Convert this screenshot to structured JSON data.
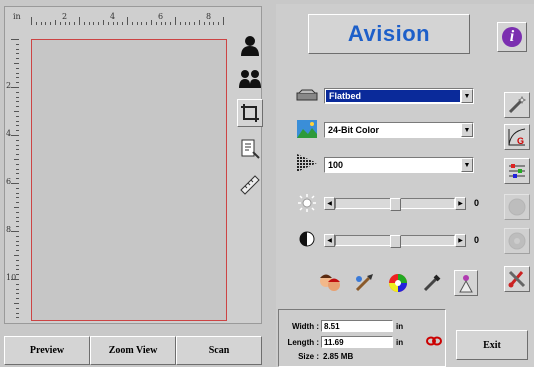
{
  "ruler": {
    "unit": "in",
    "top_labels": [
      "2",
      "4",
      "6",
      "8"
    ],
    "left_labels": [
      "2",
      "4",
      "6",
      "8",
      "10"
    ]
  },
  "left_tools": [
    "person-icon",
    "two-persons-icon",
    "crop-icon",
    "page-layout-icon",
    "ruler-icon"
  ],
  "bottom_buttons": {
    "preview": "Preview",
    "zoom_view": "Zoom View",
    "scan": "Scan"
  },
  "brand": {
    "name": "Avision",
    "color": "#1d5fc9",
    "info_glyph": "i"
  },
  "settings": {
    "source": "Flatbed",
    "color_mode": "24-Bit Color",
    "resolution": "100",
    "brightness": {
      "value": "0",
      "level": 0.5
    },
    "contrast": {
      "value": "0",
      "level": 0.5
    }
  },
  "side_tools": [
    "magic-wand-icon",
    "gamma-curve-icon",
    "color-adjust-icon",
    "disabled-icon-1",
    "disabled-icon-2",
    "tools-icon"
  ],
  "effect_buttons": [
    "faces-icon",
    "brush-icon",
    "color-wheel-icon",
    "eyedropper-icon",
    "filter-icon"
  ],
  "size": {
    "width_label": "Width :",
    "width_value": "8.51",
    "width_unit": "in",
    "length_label": "Length :",
    "length_value": "11.69",
    "length_unit": "in",
    "size_label": "Size :",
    "size_value": "2.85 MB"
  },
  "exit_label": "Exit"
}
